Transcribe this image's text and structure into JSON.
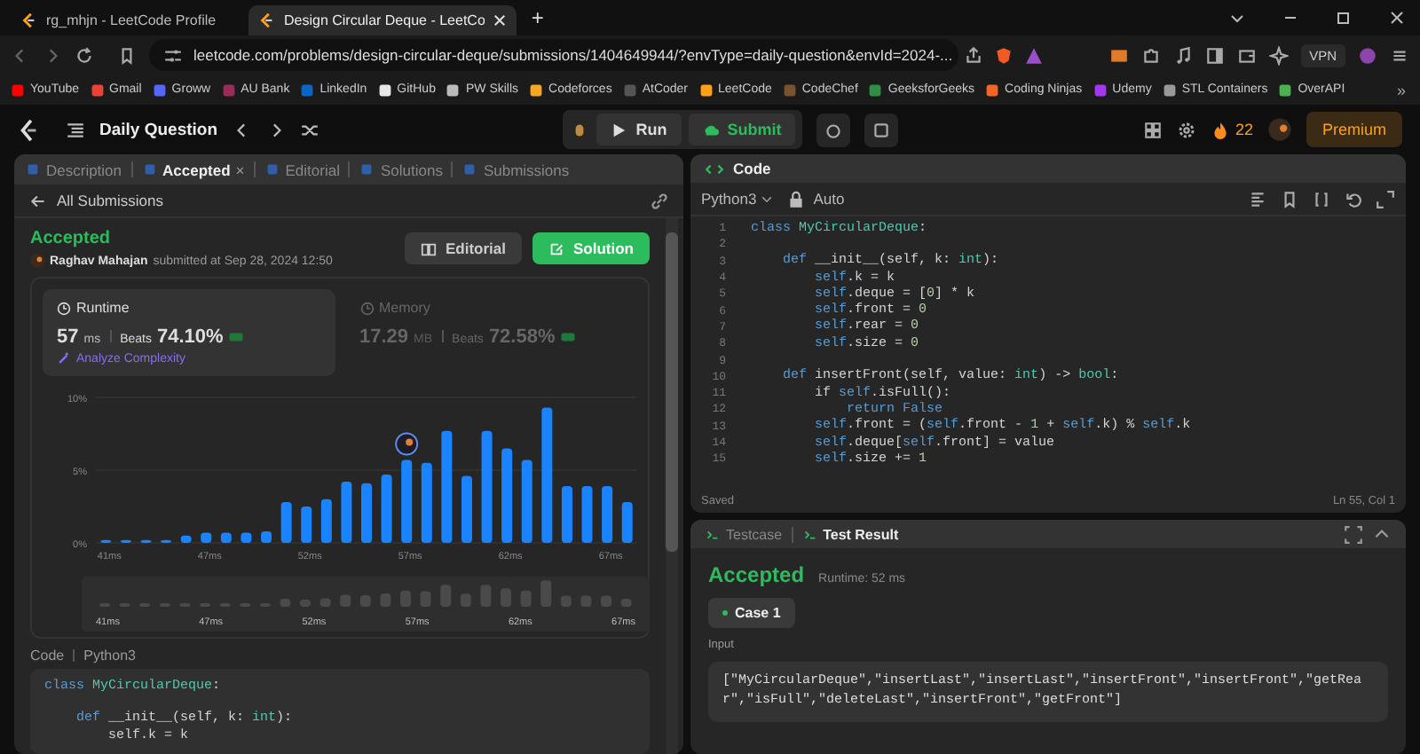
{
  "browser": {
    "tabs": [
      {
        "title": "rg_mhjn - LeetCode Profile",
        "selected": false
      },
      {
        "title": "Design Circular Deque - LeetCo",
        "selected": true
      }
    ],
    "new_tab": "+",
    "url": "leetcode.com/problems/design-circular-deque/submissions/1404649944/?envType=daily-question&envId=2024-...",
    "vpn": "VPN",
    "bookmarks": [
      {
        "label": "YouTube",
        "color": "#ff0000"
      },
      {
        "label": "Gmail",
        "color": "#ea4335"
      },
      {
        "label": "Groww",
        "color": "#5367ff"
      },
      {
        "label": "AU Bank",
        "color": "#9b2c5a"
      },
      {
        "label": "LinkedIn",
        "color": "#0a66c2"
      },
      {
        "label": "GitHub",
        "color": "#e6e6e6"
      },
      {
        "label": "PW Skills",
        "color": "#bbbbbb"
      },
      {
        "label": "Codeforces",
        "color": "#f5a623"
      },
      {
        "label": "AtCoder",
        "color": "#555555"
      },
      {
        "label": "LeetCode",
        "color": "#ffa116"
      },
      {
        "label": "CodeChef",
        "color": "#7a5230"
      },
      {
        "label": "GeeksforGeeks",
        "color": "#2f8d46"
      },
      {
        "label": "Coding Ninjas",
        "color": "#f26522"
      },
      {
        "label": "Udemy",
        "color": "#a435f0"
      },
      {
        "label": "STL Containers",
        "color": "#999999"
      },
      {
        "label": "OverAPI",
        "color": "#4caf50"
      }
    ],
    "more": "»"
  },
  "nav": {
    "title": "Daily Question",
    "run": "Run",
    "submit": "Submit",
    "streak": "22",
    "premium": "Premium"
  },
  "left": {
    "tabs": [
      {
        "label": "Description",
        "selected": false
      },
      {
        "label": "Accepted",
        "selected": true,
        "close": "×"
      },
      {
        "label": "Editorial",
        "selected": false
      },
      {
        "label": "Solutions",
        "selected": false
      },
      {
        "label": "Submissions",
        "selected": false
      }
    ],
    "back": "All Submissions",
    "status": "Accepted",
    "author": "Raghav Mahajan",
    "submitted": "submitted at Sep 28, 2024 12:50",
    "editorial": "Editorial",
    "solution": "Solution",
    "stats": [
      {
        "title": "Runtime",
        "value": "57",
        "unit": "ms",
        "beats_label": "Beats",
        "beats": "74.10%",
        "selected": true,
        "link": "Analyze Complexity"
      },
      {
        "title": "Memory",
        "value": "17.29",
        "unit": "MB",
        "beats_label": "Beats",
        "beats": "72.58%",
        "selected": false
      }
    ],
    "chart_data": {
      "type": "bar",
      "categories": [
        "41ms",
        null,
        null,
        null,
        null,
        "47ms",
        null,
        null,
        null,
        null,
        "52ms",
        null,
        null,
        null,
        null,
        "57ms",
        null,
        null,
        null,
        null,
        "62ms",
        null,
        null,
        null,
        null,
        "67ms",
        null
      ],
      "values": [
        0.2,
        0.2,
        0.2,
        0.2,
        0.5,
        0.7,
        0.7,
        0.7,
        0.8,
        2.8,
        2.5,
        3.0,
        4.2,
        4.1,
        4.7,
        5.7,
        5.5,
        7.7,
        4.6,
        7.7,
        6.5,
        5.7,
        9.3,
        3.9,
        3.9,
        3.9,
        2.8
      ],
      "ylim": [
        0,
        10
      ],
      "yticks": [
        {
          "value": 0,
          "label": "0%"
        },
        {
          "value": 5,
          "label": "5%"
        },
        {
          "value": 10,
          "label": "10%"
        }
      ]
    },
    "overview_labels": [
      "41ms",
      "47ms",
      "52ms",
      "57ms",
      "62ms",
      "67ms"
    ],
    "code_label": "Code",
    "language": "Python3",
    "code": [
      {
        "segments": [
          {
            "kind": "kw",
            "text": "class "
          },
          {
            "kind": "cls",
            "text": "MyCircularDeque"
          },
          {
            "kind": "plain",
            "text": ":"
          }
        ]
      },
      {
        "space_before": true,
        "segments": [
          {
            "kind": "kw",
            "text": "    def "
          },
          {
            "kind": "plain",
            "text": "__init__(self, k: "
          },
          {
            "kind": "cls",
            "text": "int"
          },
          {
            "kind": "plain",
            "text": "):"
          }
        ]
      },
      {
        "segments": [
          {
            "kind": "plain",
            "text": "        self.k = k"
          }
        ]
      }
    ]
  },
  "editor": {
    "title": "Code",
    "language": "Python3",
    "mode": "Auto",
    "lines": [
      {
        "number": "1",
        "segments": [
          {
            "kind": "kw",
            "text": "class "
          },
          {
            "kind": "cls",
            "text": "MyCircularDeque"
          },
          {
            "kind": "plain",
            "text": ":"
          }
        ]
      },
      {
        "number": "2"
      },
      {
        "number": "3",
        "segments": [
          {
            "kind": "kw",
            "text": "    def "
          },
          {
            "kind": "plain",
            "text": "__init__(self, k: "
          },
          {
            "kind": "cls",
            "text": "int"
          },
          {
            "kind": "plain",
            "text": "):"
          }
        ]
      },
      {
        "number": "4",
        "segments": [
          {
            "kind": "kw",
            "text": "        self"
          },
          {
            "kind": "plain",
            "text": ".k = k"
          }
        ]
      },
      {
        "number": "5",
        "segments": [
          {
            "kind": "kw",
            "text": "        self"
          },
          {
            "kind": "plain",
            "text": ".deque = ["
          },
          {
            "kind": "num",
            "text": "0"
          },
          {
            "kind": "plain",
            "text": "] * k"
          }
        ]
      },
      {
        "number": "6",
        "segments": [
          {
            "kind": "kw",
            "text": "        self"
          },
          {
            "kind": "plain",
            "text": ".front = "
          },
          {
            "kind": "num",
            "text": "0"
          }
        ]
      },
      {
        "number": "7",
        "segments": [
          {
            "kind": "kw",
            "text": "        self"
          },
          {
            "kind": "plain",
            "text": ".rear = "
          },
          {
            "kind": "num",
            "text": "0"
          }
        ]
      },
      {
        "number": "8",
        "segments": [
          {
            "kind": "kw",
            "text": "        self"
          },
          {
            "kind": "plain",
            "text": ".size = "
          },
          {
            "kind": "num",
            "text": "0"
          }
        ]
      },
      {
        "number": "9"
      },
      {
        "number": "10",
        "segments": [
          {
            "kind": "kw",
            "text": "    def "
          },
          {
            "kind": "plain",
            "text": "insertFront(self, value: "
          },
          {
            "kind": "cls",
            "text": "int"
          },
          {
            "kind": "plain",
            "text": ") -> "
          },
          {
            "kind": "cls",
            "text": "bool"
          },
          {
            "kind": "plain",
            "text": ":"
          }
        ]
      },
      {
        "number": "11",
        "segments": [
          {
            "kind": "plain",
            "text": "        if "
          },
          {
            "kind": "kw",
            "text": "self"
          },
          {
            "kind": "plain",
            "text": ".isFull():"
          }
        ]
      },
      {
        "number": "12",
        "segments": [
          {
            "kind": "kw",
            "text": "            return False"
          }
        ]
      },
      {
        "number": "13",
        "segments": [
          {
            "kind": "kw",
            "text": "        self"
          },
          {
            "kind": "plain",
            "text": ".front = ("
          },
          {
            "kind": "kw",
            "text": "self"
          },
          {
            "kind": "plain",
            "text": ".front - "
          },
          {
            "kind": "num",
            "text": "1"
          },
          {
            "kind": "plain",
            "text": " + "
          },
          {
            "kind": "kw",
            "text": "self"
          },
          {
            "kind": "plain",
            "text": ".k) % "
          },
          {
            "kind": "kw",
            "text": "self"
          },
          {
            "kind": "plain",
            "text": ".k"
          }
        ]
      },
      {
        "number": "14",
        "segments": [
          {
            "kind": "kw",
            "text": "        self"
          },
          {
            "kind": "plain",
            "text": ".deque["
          },
          {
            "kind": "kw",
            "text": "self"
          },
          {
            "kind": "plain",
            "text": ".front] = value"
          }
        ]
      },
      {
        "number": "15",
        "segments": [
          {
            "kind": "kw",
            "text": "        self"
          },
          {
            "kind": "plain",
            "text": ".size += "
          },
          {
            "kind": "num",
            "text": "1"
          }
        ]
      }
    ],
    "status": "Saved",
    "cursor": "Ln 55, Col 1"
  },
  "result": {
    "tabs": [
      {
        "label": "Testcase",
        "selected": false
      },
      {
        "label": "Test Result",
        "selected": true
      }
    ],
    "status": "Accepted",
    "runtime": "Runtime: 52 ms",
    "cases": [
      {
        "label": "Case 1",
        "selected": true
      }
    ],
    "input_label": "Input",
    "input": "[\"MyCircularDeque\",\"insertLast\",\"insertLast\",\"insertFront\",\"insertFront\",\"getRear\",\"isFull\",\"deleteLast\",\"insertFront\",\"getFront\"]"
  }
}
